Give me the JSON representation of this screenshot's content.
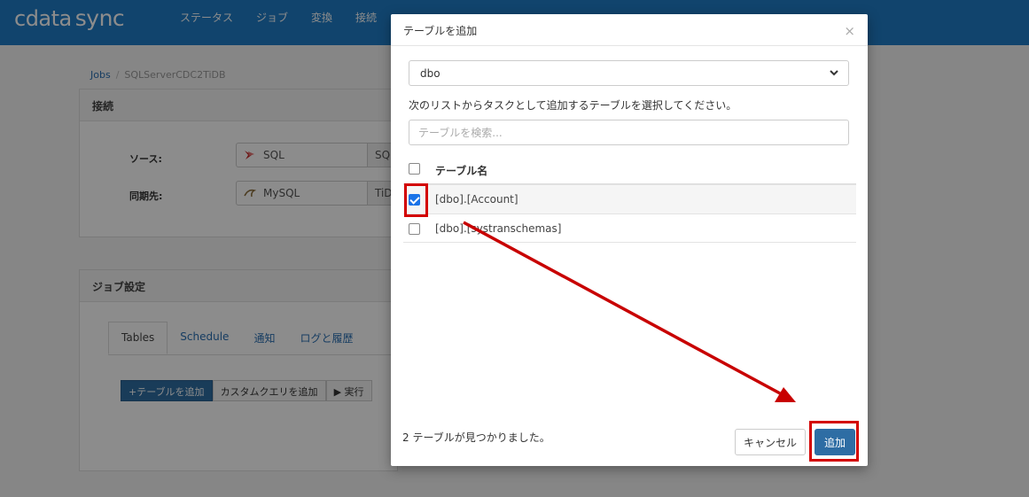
{
  "app": {
    "logo_main": "cdata",
    "logo_sync": "sync",
    "nav": [
      "ステータス",
      "ジョブ",
      "変換",
      "接続",
      "",
      "",
      ""
    ],
    "breadcrumb": {
      "root": "Jobs",
      "sep": "/",
      "current": "SQLServerCDC2TiDB"
    },
    "connection_panel": {
      "title": "接続",
      "source_label": "ソース:",
      "source_value": "SQL",
      "source_suffix": "SQ",
      "dest_label": "同期先:",
      "dest_value": "MySQL",
      "dest_suffix": "TiD"
    },
    "job_panel": {
      "title": "ジョブ設定",
      "tabs": [
        "Tables",
        "Schedule",
        "通知",
        "ログと履歴"
      ],
      "buttons": {
        "add_table": "+テーブルを追加",
        "add_query": "カスタムクエリを追加",
        "run": "▶ 実行"
      }
    }
  },
  "modal": {
    "title": "テーブルを追加",
    "close": "×",
    "schema_selected": "dbo",
    "instruction": "次のリストからタスクとして追加するテーブルを選択してください。",
    "search_placeholder": "テーブルを検索...",
    "table_header": "テーブル名",
    "rows": [
      {
        "name": "[dbo].[Account]",
        "checked": true
      },
      {
        "name": "[dbo].[systranschemas]",
        "checked": false
      }
    ],
    "found_count": "2 テーブルが見つかりました。",
    "cancel_label": "キャンセル",
    "add_label": "追加"
  },
  "colors": {
    "topbar": "#1f7cc7",
    "primary_button": "#2e6da4",
    "highlight": "#d30000"
  }
}
